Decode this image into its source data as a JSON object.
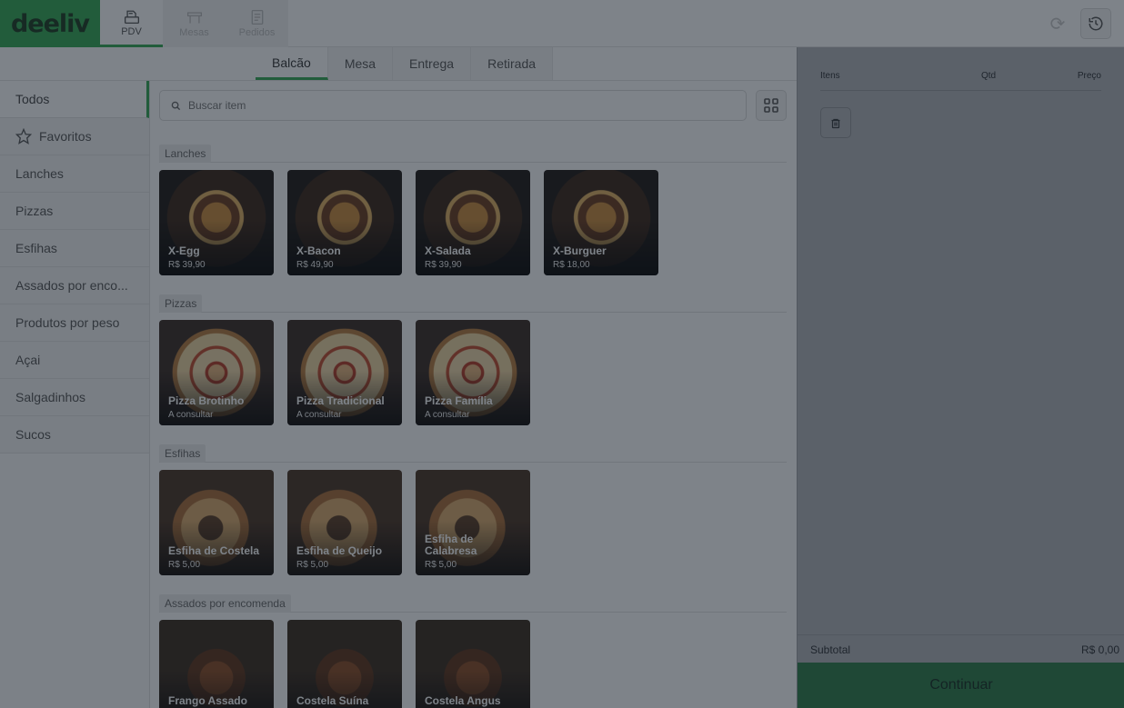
{
  "brand": {
    "logo_text": "deeliv",
    "accent": "#34a853"
  },
  "nav": [
    {
      "label": "PDV",
      "icon": "register-icon",
      "state": "active"
    },
    {
      "label": "Mesas",
      "icon": "table-icon",
      "state": "disabled"
    },
    {
      "label": "Pedidos",
      "icon": "orders-icon",
      "state": "disabled"
    }
  ],
  "order_types": [
    "Balcão",
    "Mesa",
    "Entrega",
    "Retirada"
  ],
  "active_order_type": "Balcão",
  "categories": [
    {
      "label": "Todos",
      "active": true
    },
    {
      "label": "Favoritos",
      "icon": "star-icon"
    },
    {
      "label": "Lanches"
    },
    {
      "label": "Pizzas"
    },
    {
      "label": "Esfihas"
    },
    {
      "label": "Assados por enco..."
    },
    {
      "label": "Produtos por peso"
    },
    {
      "label": "Açai"
    },
    {
      "label": "Salgadinhos"
    },
    {
      "label": "Sucos"
    }
  ],
  "search": {
    "placeholder": "Buscar item",
    "value": ""
  },
  "sections": [
    {
      "label": "Lanches",
      "items": [
        {
          "name": "X-Egg",
          "price": "R$ 39,90",
          "img": "burger"
        },
        {
          "name": "X-Bacon",
          "price": "R$ 49,90",
          "img": "burger"
        },
        {
          "name": "X-Salada",
          "price": "R$ 39,90",
          "img": "burger"
        },
        {
          "name": "X-Burguer",
          "price": "R$ 18,00",
          "img": "burger"
        }
      ]
    },
    {
      "label": "Pizzas",
      "items": [
        {
          "name": "Pizza Brotinho",
          "price": "A consultar",
          "img": "pizza"
        },
        {
          "name": "Pizza Tradicional",
          "price": "A consultar",
          "img": "pizza"
        },
        {
          "name": "Pizza Família",
          "price": "A consultar",
          "img": "pizza"
        }
      ]
    },
    {
      "label": "Esfihas",
      "items": [
        {
          "name": "Esfiha de Costela",
          "price": "R$ 5,00",
          "img": "esfiha"
        },
        {
          "name": "Esfiha de Queijo",
          "price": "R$ 5,00",
          "img": "esfiha"
        },
        {
          "name": "Esfiha de Calabresa",
          "price": "R$ 5,00",
          "img": "esfiha"
        }
      ]
    },
    {
      "label": "Assados por encomenda",
      "items": [
        {
          "name": "Frango Assado",
          "price": "",
          "img": "roast"
        },
        {
          "name": "Costela Suína",
          "price": "",
          "img": "roast"
        },
        {
          "name": "Costela Angus",
          "price": "",
          "img": "roast"
        }
      ]
    }
  ],
  "order_panel": {
    "col_items": "Itens",
    "col_qty": "Qtd",
    "col_price": "Preço",
    "subtotal_label": "Subtotal",
    "subtotal_value": "R$ 0,00",
    "continue_label": "Continuar"
  }
}
